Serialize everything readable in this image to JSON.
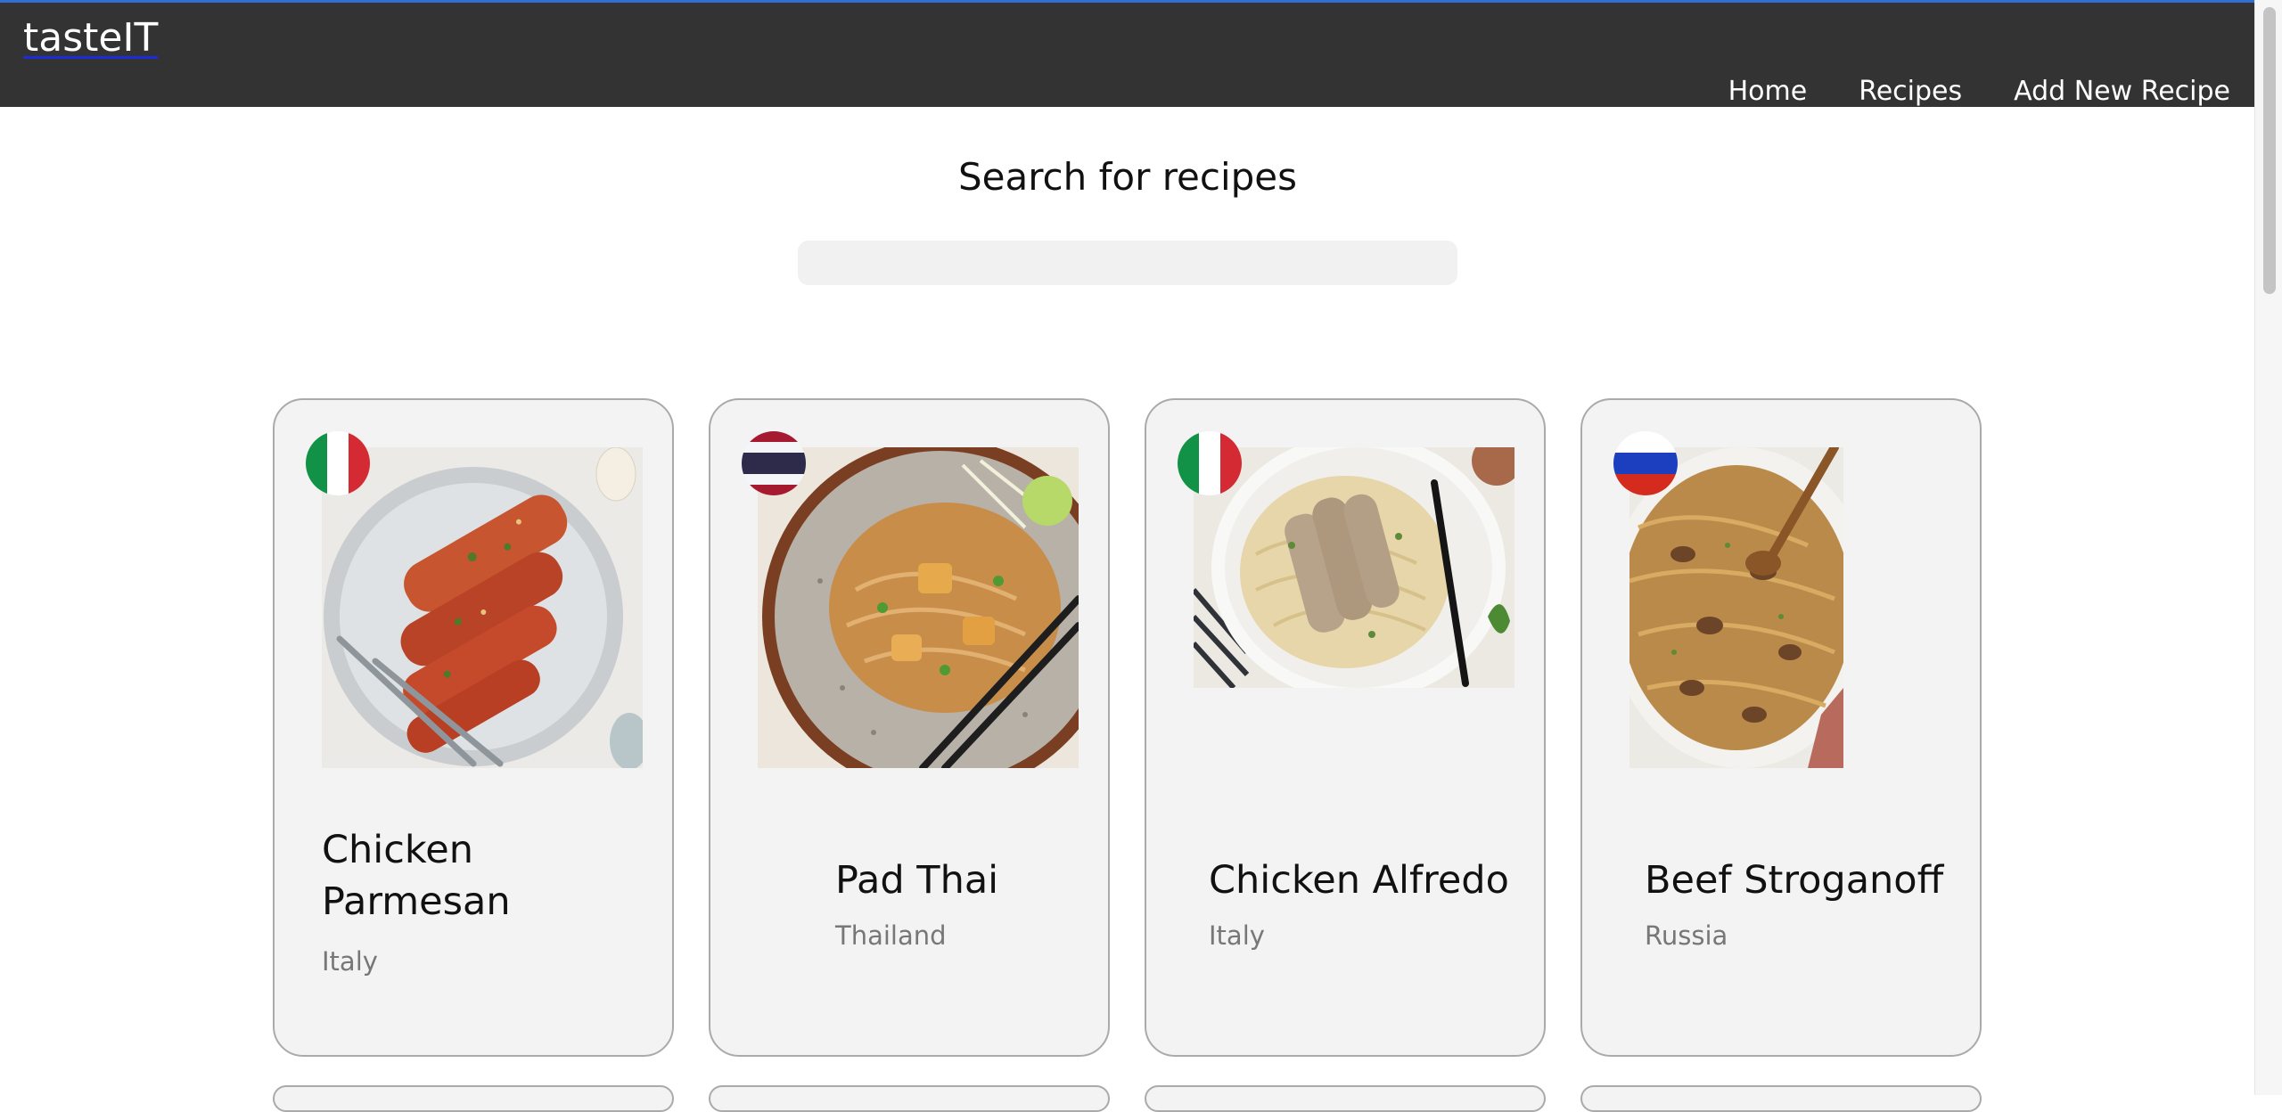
{
  "navbar": {
    "brand": "tasteIT",
    "links": [
      "Home",
      "Recipes",
      "Add New Recipe"
    ]
  },
  "search": {
    "title": "Search for recipes",
    "placeholder": "",
    "value": ""
  },
  "recipes": [
    {
      "name": "Chicken Parmesan",
      "country": "Italy",
      "flag_icon": "italy-flag-icon"
    },
    {
      "name": "Pad Thai",
      "country": "Thailand",
      "flag_icon": "thailand-flag-icon"
    },
    {
      "name": "Chicken Alfredo",
      "country": "Italy",
      "flag_icon": "italy-flag-icon"
    },
    {
      "name": "Beef Stroganoff",
      "country": "Russia",
      "flag_icon": "russia-flag-icon"
    }
  ],
  "colors": {
    "navbar": "#333333",
    "card_background": "#f3f3f3",
    "card_border": "#a9aaad",
    "top_accent": "#2f6fd6"
  }
}
